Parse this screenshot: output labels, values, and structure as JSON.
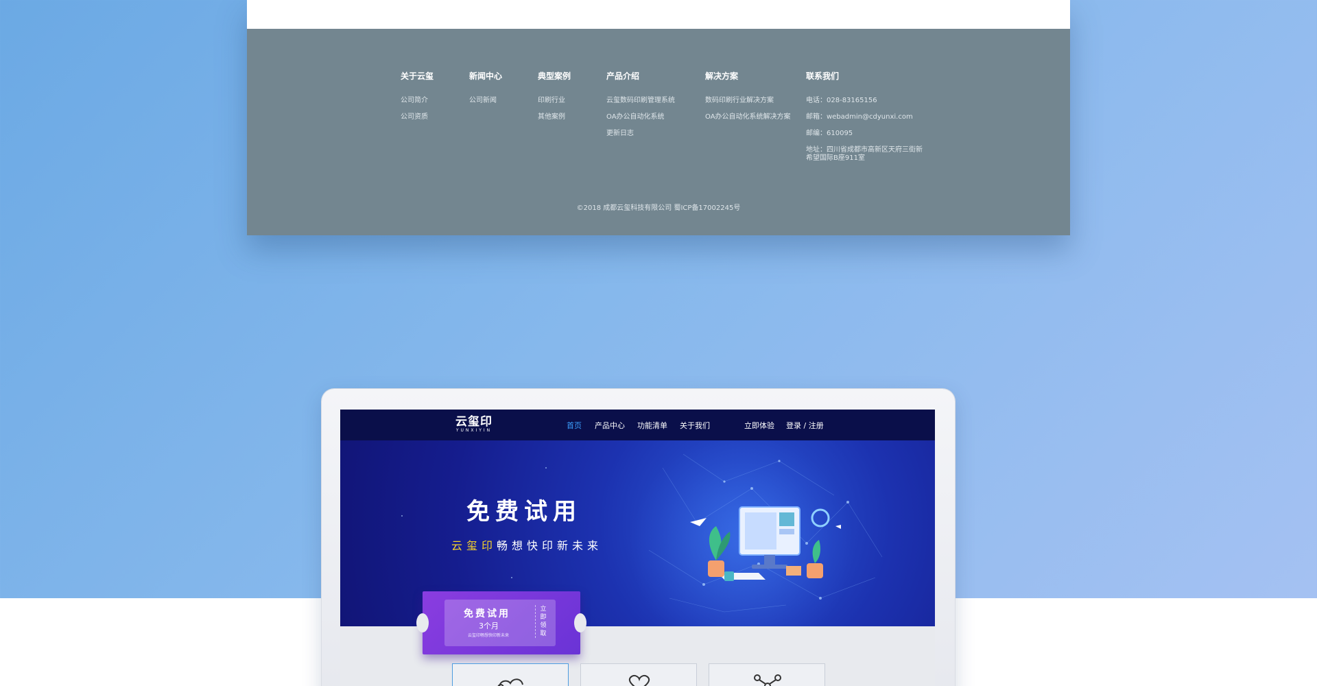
{
  "footer": {
    "columns": [
      {
        "title": "关于云玺",
        "links": [
          "公司简介",
          "公司资质"
        ]
      },
      {
        "title": "新闻中心",
        "links": [
          "公司新闻"
        ]
      },
      {
        "title": "典型案例",
        "links": [
          "印刷行业",
          "其他案例"
        ]
      },
      {
        "title": "产品介绍",
        "links": [
          "云玺数码印刷管理系统",
          "OA办公自动化系统",
          "更新日志"
        ]
      },
      {
        "title": "解决方案",
        "links": [
          "数码印刷行业解决方案",
          "OA办公自动化系统解决方案"
        ]
      },
      {
        "title": "联系我们",
        "lines": [
          "电话：028-83165156",
          "邮箱：webadmin@cdyunxi.com",
          "邮编：610095",
          "地址：四川省成都市高新区天府三街新希望国际B座911室"
        ]
      }
    ],
    "copyright": "©2018 成都云玺科技有限公司 蜀ICP备17002245号"
  },
  "screen": {
    "logo": {
      "text": "云玺印",
      "sub": "YUNXIYIN"
    },
    "nav": [
      "首页",
      "产品中心",
      "功能清单",
      "关于我们",
      "立即体验",
      "登录 / 注册"
    ],
    "hero": {
      "title": "免费试用",
      "subtitle_brand": "云玺印",
      "subtitle_rest": "畅想快印新未来"
    },
    "ticket": {
      "title": "免费试用",
      "months": "3个月",
      "small": "云玺印畅想快印新未来",
      "side": "立即领取"
    }
  },
  "colors": {
    "footer_bg": "#738690",
    "nav_bg": "#0a0f4a",
    "nav_active": "#3ca0ff",
    "brand_yellow": "#f7d22a",
    "ticket": "#7a38dc"
  }
}
